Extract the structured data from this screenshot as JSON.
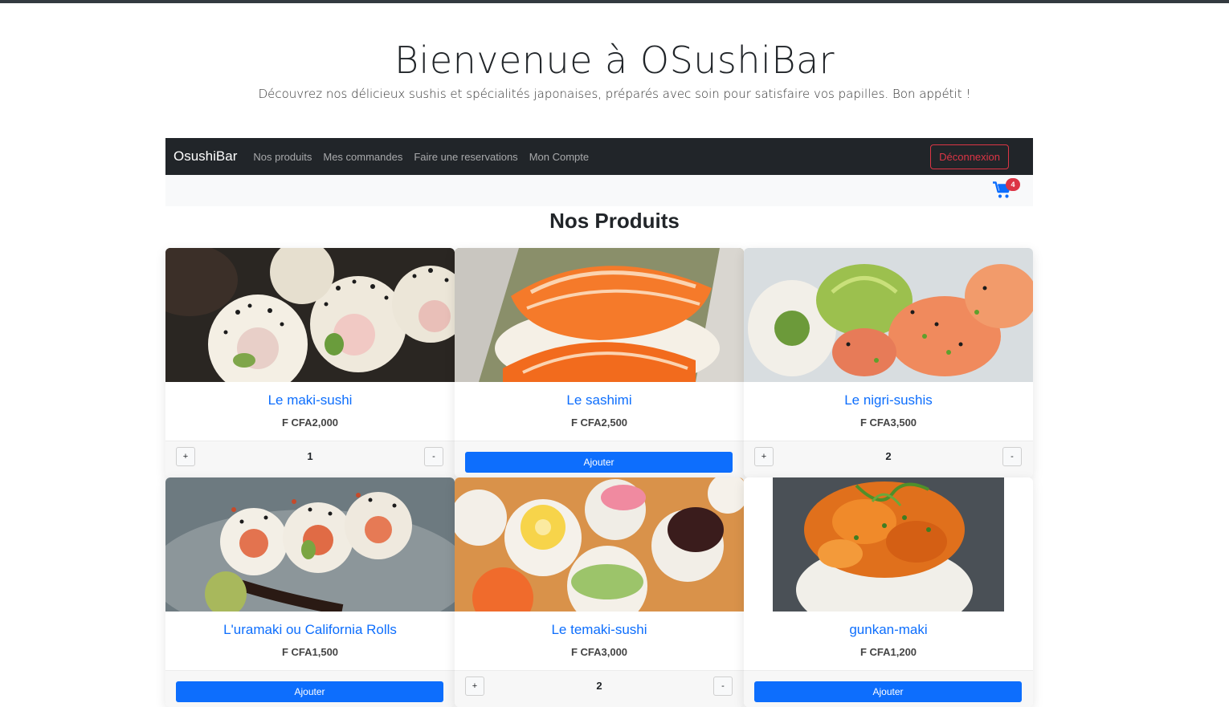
{
  "hero": {
    "title": "Bienvenue à OSushiBar",
    "subtitle": "Découvrez nos délicieux sushis et spécialités japonaises, préparés avec soin pour satisfaire vos papilles. Bon appétit !"
  },
  "navbar": {
    "brand": "OsushiBar",
    "links": [
      "Nos produits",
      "Mes commandes",
      "Faire une reservations",
      "Mon Compte"
    ],
    "logout_label": "Déconnexion"
  },
  "cart": {
    "icon": "cart-icon",
    "count": "4",
    "color": "#0d6efd"
  },
  "section_title": "Nos Produits",
  "products": [
    {
      "name": "Le maki-sushi",
      "price": "F CFA2,000",
      "in_cart": true,
      "quantity": "1",
      "image": "maki-sushi-photo"
    },
    {
      "name": "Le sashimi",
      "price": "F CFA2,500",
      "in_cart": false,
      "add_label": "Ajouter",
      "image": "sashimi-photo"
    },
    {
      "name": "Le nigri-sushis",
      "price": "F CFA3,500",
      "in_cart": true,
      "quantity": "2",
      "image": "nigiri-photo"
    },
    {
      "name": "L'uramaki ou California Rolls",
      "price": "F CFA1,500",
      "in_cart": false,
      "add_label": "Ajouter",
      "image": "uramaki-photo"
    },
    {
      "name": "Le temaki-sushi",
      "price": "F CFA3,000",
      "in_cart": true,
      "quantity": "2",
      "image": "temaki-photo"
    },
    {
      "name": "gunkan-maki",
      "price": "F CFA1,200",
      "in_cart": false,
      "add_label": "Ajouter",
      "image": "gunkan-photo"
    }
  ],
  "qty_controls": {
    "plus": "+",
    "minus": "-"
  },
  "colors": {
    "primary": "#0d6efd",
    "danger": "#dc3545",
    "navbar": "#212529"
  }
}
